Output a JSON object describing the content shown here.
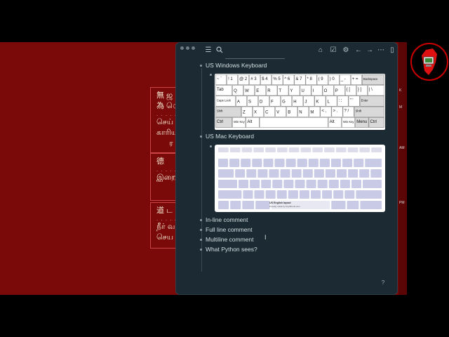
{
  "background": {
    "box1_lines": [
      "無 ஜ",
      "為 ெ",
      "செய்",
      "காரிய",
      "ர"
    ],
    "box2_lines": [
      "德",
      "இறை"
    ],
    "box3_lines": [
      "道 ட",
      "நீர் வழ",
      "செய"
    ],
    "right_strip": [
      "K",
      "M",
      "AM",
      "PM"
    ]
  },
  "notes": {
    "items": [
      {
        "label": "US Windows Keyboard"
      },
      {
        "label": "US Mac Keyboard"
      },
      {
        "label": "In-line comment"
      },
      {
        "label": "Full line comment"
      },
      {
        "label": "Multiline comment"
      },
      {
        "label": "What Python sees?"
      }
    ],
    "help_label": "?"
  },
  "windows_keyboard": {
    "rows": [
      [
        "~ `",
        "! 1",
        "@ 2",
        "# 3",
        "$ 4",
        "% 5",
        "^ 6",
        "& 7",
        "* 8",
        "( 9",
        ") 0",
        "_ -",
        "+ =",
        "Backspace"
      ],
      [
        "Tab",
        "Q",
        "W",
        "E",
        "R",
        "T",
        "Y",
        "U",
        "I",
        "O",
        "P",
        "{ [",
        "} ]",
        "| \\"
      ],
      [
        "Caps Lock",
        "A",
        "S",
        "D",
        "F",
        "G",
        "H",
        "J",
        "K",
        "L",
        ": ;",
        "\" '",
        "Enter"
      ],
      [
        "Shift",
        "Z",
        "X",
        "C",
        "V",
        "B",
        "N",
        "M",
        "< ,",
        "> .",
        "? /",
        "Shift"
      ],
      [
        "Ctrl",
        "Win Key",
        "Alt",
        "",
        "Alt",
        "Win Key",
        "Menu",
        "Ctrl"
      ]
    ]
  },
  "mac_keyboard": {
    "caption_title": "US English layout",
    "caption_sub": "Proudly made by KeyShorts.com"
  }
}
